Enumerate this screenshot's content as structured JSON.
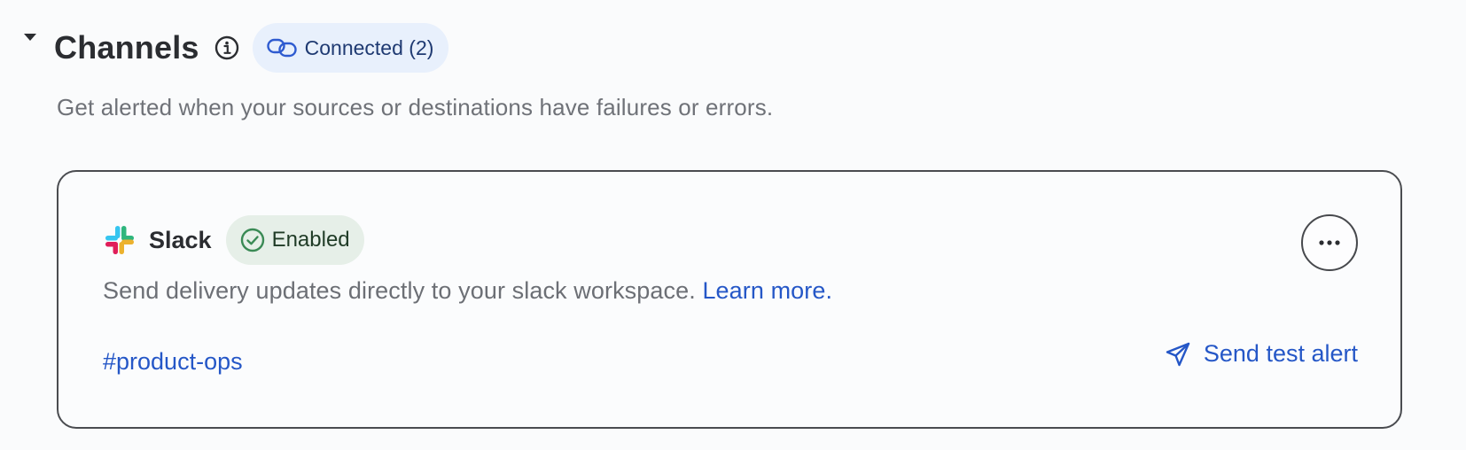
{
  "section": {
    "title": "Channels",
    "connected_badge": "Connected (2)",
    "subtitle": "Get alerted when your sources or destinations have failures or errors."
  },
  "channels": [
    {
      "name": "Slack",
      "icon": "slack-logo-icon",
      "status": "Enabled",
      "description": "Send delivery updates directly to your slack workspace.",
      "learn_more": "Learn more.",
      "channel_tag": "#product-ops",
      "send_test_label": "Send test alert"
    }
  ],
  "colors": {
    "accent": "#2557c7",
    "connected_badge_bg": "#e8f0fc",
    "enabled_badge_bg": "#e6efe8",
    "enabled_check": "#3a8a55",
    "border": "#4a4c50"
  }
}
